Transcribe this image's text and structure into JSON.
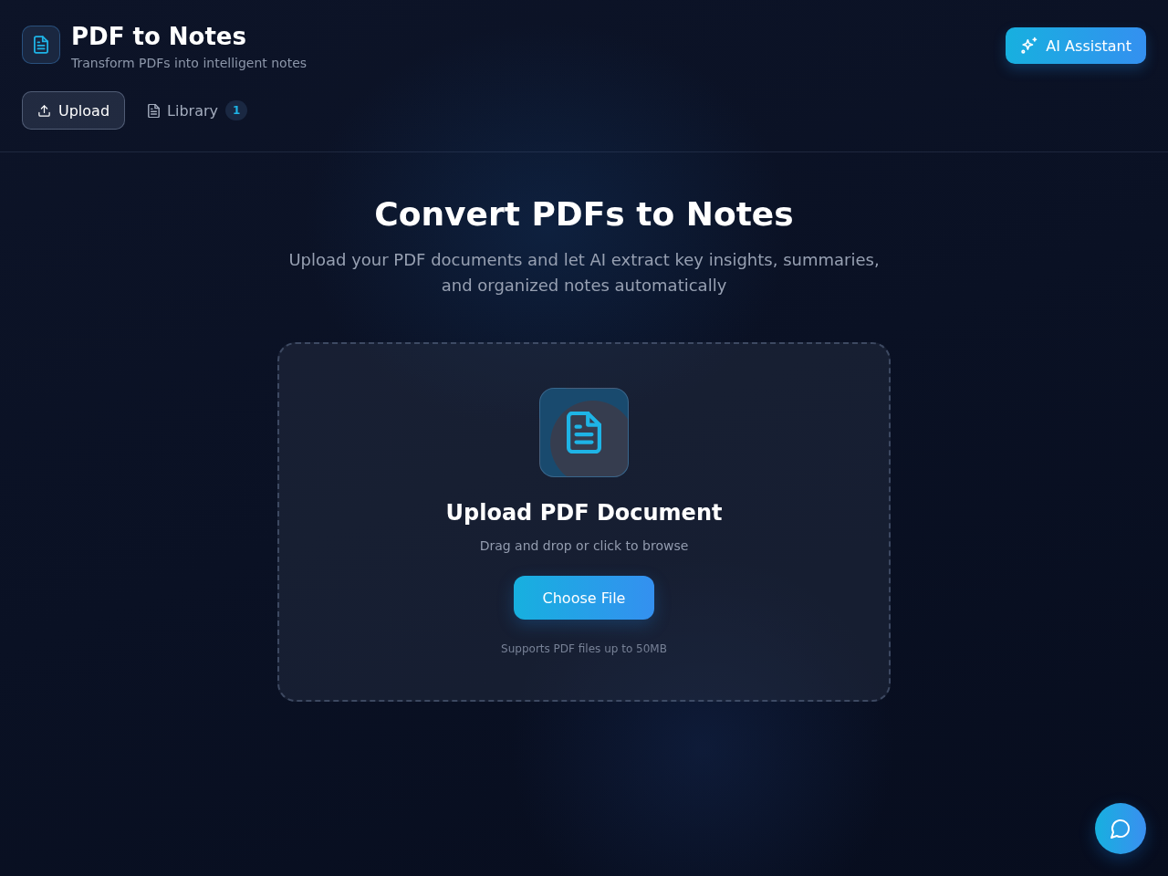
{
  "header": {
    "title": "PDF to Notes",
    "subtitle": "Transform PDFs into intelligent notes",
    "assistant_button": "AI Assistant"
  },
  "tabs": [
    {
      "label": "Upload",
      "kind": "upload",
      "selected": true
    },
    {
      "label": "Library",
      "kind": "library",
      "selected": false,
      "badge": "1"
    }
  ],
  "hero": {
    "title": "Convert PDFs to Notes",
    "subtitle": "Upload your PDF documents and let AI extract key insights, summaries, and organized notes automatically"
  },
  "dropzone": {
    "title": "Upload PDF Document",
    "hint": "Drag and drop or click to browse",
    "button": "Choose File",
    "note": "Supports PDF files up to 50MB"
  }
}
